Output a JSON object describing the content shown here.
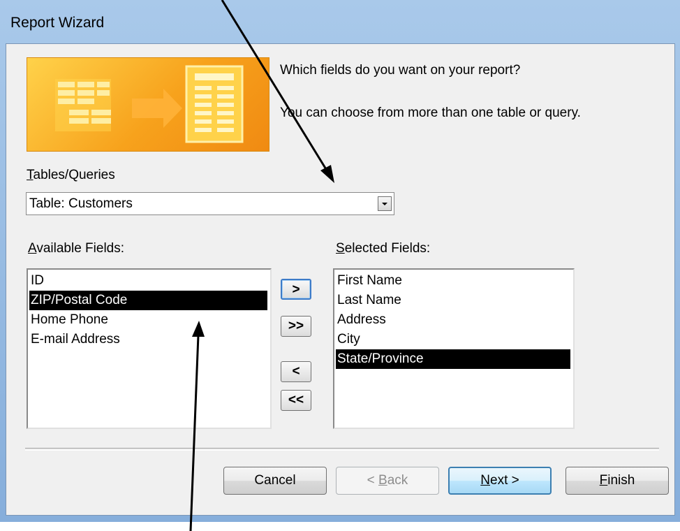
{
  "window": {
    "title": "Report Wizard"
  },
  "wizard": {
    "prompt": "Which fields do you want on your report?",
    "hint": "You can choose from more than one table or query.",
    "tables_label_accel": "T",
    "tables_label_rest": "ables/Queries",
    "tables_value": "Table: Customers",
    "available_label_accel": "A",
    "available_label_rest": "vailable Fields:",
    "selected_label_accel": "S",
    "selected_label_rest": "elected Fields:",
    "available_fields": [
      "ID",
      "ZIP/Postal Code",
      "Home Phone",
      "E-mail Address"
    ],
    "available_selected_index": 1,
    "selected_fields": [
      "First Name",
      "Last Name",
      "Address",
      "City",
      "State/Province"
    ],
    "selected_selected_index": 4
  },
  "move_buttons": {
    "add_one": ">",
    "add_all": ">>",
    "remove_one": "<",
    "remove_all": "<<"
  },
  "buttons": {
    "cancel": "Cancel",
    "back_prefix": "< ",
    "back_accel": "B",
    "back_rest": "ack",
    "next_accel": "N",
    "next_rest": "ext >",
    "finish_accel": "F",
    "finish_rest": "inish"
  },
  "colors": {
    "banner": "#f7a21c",
    "selection": "#000000",
    "default_button_border": "#3c7fb1"
  }
}
